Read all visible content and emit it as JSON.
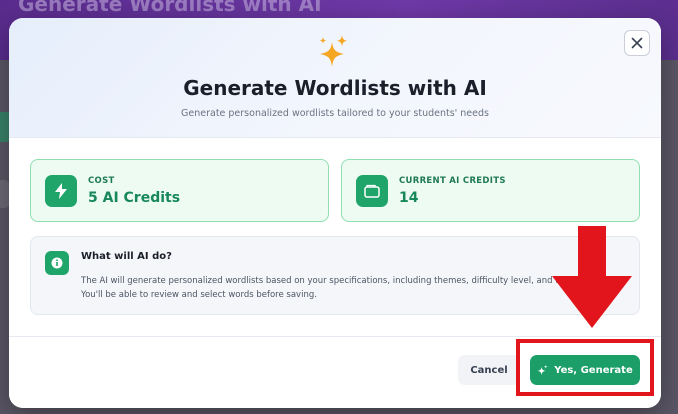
{
  "backdrop": {
    "title": "Generate Wordlists with AI"
  },
  "modal": {
    "title": "Generate Wordlists with AI",
    "subtitle": "Generate personalized wordlists tailored to your students' needs",
    "header_icon": "sparkles-icon",
    "close_icon": "close-icon"
  },
  "cards": {
    "cost": {
      "label": "COST",
      "value": "5 AI Credits",
      "icon": "lightning-icon"
    },
    "credits": {
      "label": "CURRENT AI CREDITS",
      "value": "14",
      "icon": "wallet-icon"
    }
  },
  "info": {
    "title": "What will AI do?",
    "line1": "The AI will generate personalized wordlists based on your specifications, including themes, difficulty level, and ta",
    "line2": "You'll be able to review and select words before saving.",
    "icon": "info-icon"
  },
  "footer": {
    "cancel_label": "Cancel",
    "generate_label": "Yes, Generate",
    "generate_icon": "sparkles-icon"
  },
  "colors": {
    "accent_green": "#1b9e67",
    "card_border": "#8fe0b1",
    "card_bg": "#edfbf3",
    "sparkle_orange": "#f5a623",
    "annotation_red": "#e3151c"
  }
}
